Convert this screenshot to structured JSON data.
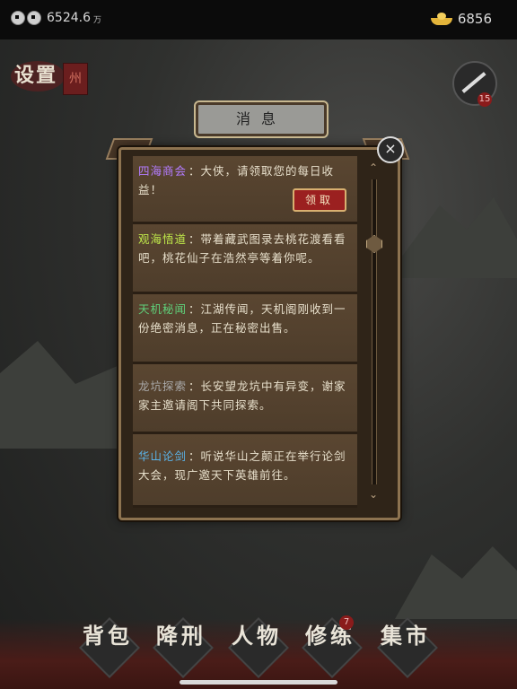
{
  "currency": {
    "silver": "6524.6",
    "silver_unit": "万",
    "gold": "6856"
  },
  "map": {
    "settings_label": "设置",
    "city_label": "州",
    "hero_badge": "15"
  },
  "dialog": {
    "title": "消息",
    "close_icon": "×",
    "messages": [
      {
        "sender": "四海商会",
        "color": "#b37cff",
        "text": "：大侠，请领取您的每日收益！",
        "button": "领取"
      },
      {
        "sender": "观海悟道",
        "color": "#bfe84a",
        "text": "：带着藏武图录去桃花渡看看吧，桃花仙子在浩然亭等着你呢。"
      },
      {
        "sender": "天机秘闻",
        "color": "#5fd07a",
        "text": "：江湖传闻，天机阁刚收到一份绝密消息，正在秘密出售。"
      },
      {
        "sender": "龙坑探索",
        "color": "#a9a9a9",
        "text": "：长安望龙坑中有异变，谢家家主邀请阁下共同探索。"
      },
      {
        "sender": "华山论剑",
        "color": "#5ab4ea",
        "text": "：听说华山之颠正在举行论剑大会，现广邀天下英雄前往。"
      }
    ],
    "scroll_up": "⌃",
    "scroll_down": "⌄"
  },
  "nav": {
    "bag": "背包",
    "subdue": "降刑",
    "characters": "人物",
    "training": "修练",
    "market": "集市",
    "training_badge": "7"
  }
}
